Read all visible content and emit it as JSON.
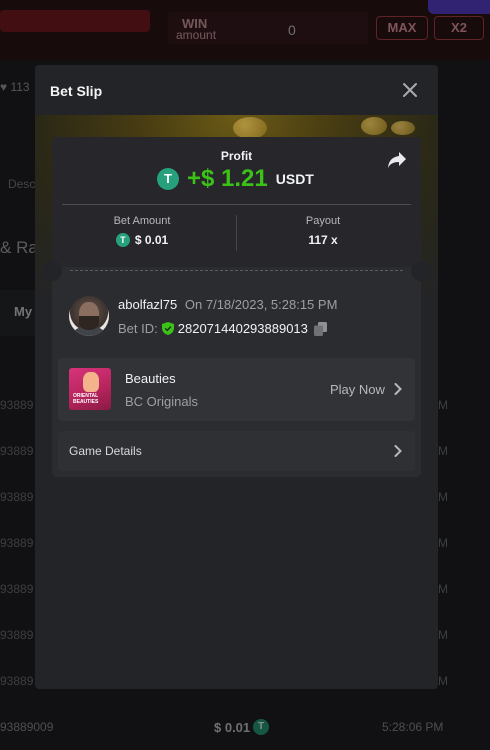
{
  "background": {
    "win_label_1": "WIN",
    "win_label_2": "amount",
    "win_value": "0",
    "max_button": "MAX",
    "x2_button": "X2",
    "likes": "113",
    "left_tab": "Desc",
    "race_label": "Rac",
    "my_tab": "My",
    "row_ids": [
      "93889",
      "93889",
      "93889",
      "93889",
      "93889",
      "93889",
      "93889"
    ],
    "row_m": [
      "M",
      "M",
      "M",
      "M",
      "M",
      "M",
      "M"
    ],
    "bottom_row": {
      "id": "93889009",
      "amount": "$ 0.01",
      "time": "5:28:06 PM"
    }
  },
  "modal": {
    "title": "Bet Slip",
    "profit_label": "Profit",
    "profit_amount": "+$ 1.21",
    "profit_currency": "USDT",
    "bet_amount_label": "Bet Amount",
    "bet_amount_value": "$ 0.01",
    "payout_label": "Payout",
    "payout_value": "117 x",
    "user_name": "abolfazl75",
    "user_date": "On 7/18/2023, 5:28:15 PM",
    "bet_id_label": "Bet ID:",
    "bet_id": "282071440293889013",
    "game_name": "Beauties",
    "game_provider": "BC Originals",
    "play_now": "Play Now",
    "game_details": "Game Details",
    "thumb_text": "ORIENTAL BEAUTIES"
  },
  "colors": {
    "profit_green": "#3bc117",
    "tether": "#26a17b",
    "shield": "#3bc117"
  }
}
